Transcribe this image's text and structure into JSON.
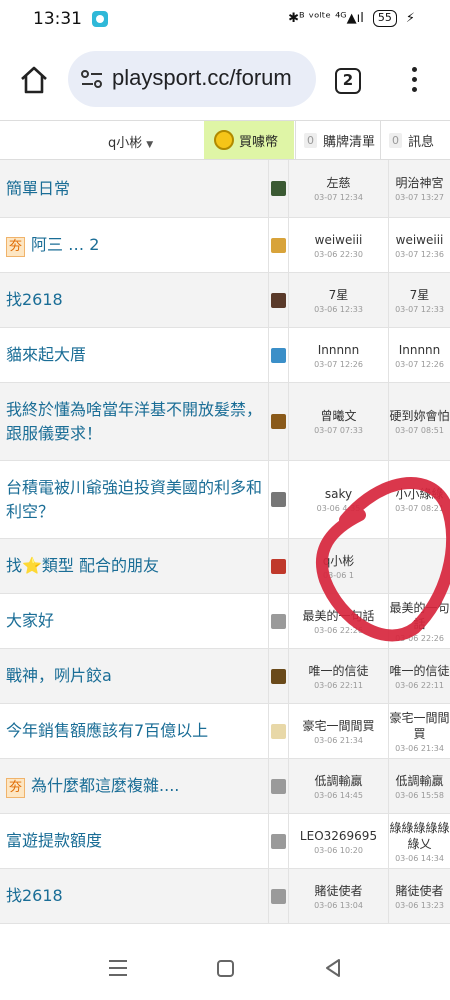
{
  "status_bar": {
    "time": "13:31",
    "indicators": "✱ᴮ ᵛᵒˡᵗᵉ ⁴ᴳ▲ıl",
    "battery": "55"
  },
  "browser": {
    "url": "playsport.cc/forum",
    "tab_count": "2"
  },
  "site_nav": {
    "user": "q小彬",
    "coin_label": "買噱幣",
    "items": [
      {
        "count": "0",
        "label": "購牌清單"
      },
      {
        "count": "0",
        "label": "訊息"
      }
    ]
  },
  "rows": [
    {
      "tag": "",
      "title": "簡單日常",
      "author": "左慈",
      "author_time": "03-07 12:34",
      "last": "明治神宮",
      "last_time": "03-07 13:27",
      "thumb_color": "#3b5a33"
    },
    {
      "tag": "夯",
      "title": "阿三 … 2",
      "author": "weiweiii",
      "author_time": "03-06 22:30",
      "last": "weiweiii",
      "last_time": "03-07 12:36",
      "thumb_color": "#d8a33a"
    },
    {
      "tag": "",
      "title": "找2618",
      "author": "7星",
      "author_time": "03-06 12:33",
      "last": "7星",
      "last_time": "03-07 12:33",
      "thumb_color": "#5a3a2a"
    },
    {
      "tag": "",
      "title": "貓來起大厝",
      "author": "Innnnn",
      "author_time": "03-07 12:26",
      "last": "Innnnn",
      "last_time": "03-07 12:26",
      "thumb_color": "#3b8fc8"
    },
    {
      "tag": "",
      "title": "我終於懂為啥當年洋基不開放髮禁，跟服儀要求！",
      "author": "曾曦文",
      "author_time": "03-07 07:33",
      "last": "硬到妳會怕",
      "last_time": "03-07 08:51",
      "thumb_color": "#8a5a1a"
    },
    {
      "tag": "",
      "title": "台積電被川爺強迫投資美國的利多和利空？",
      "author": "saky",
      "author_time": "03-06 4:35",
      "last": "小小綠綠",
      "last_time": "03-07 08:21",
      "thumb_color": "#777777"
    },
    {
      "tag": "",
      "title": "找⭐類型 配合的朋友",
      "author": "q小彬",
      "author_time": "03-06 1",
      "last": "",
      "last_time": "",
      "thumb_color": "#c0392b"
    },
    {
      "tag": "",
      "title": "大家好",
      "author": "最美的一句話",
      "author_time": "03-06 22:26",
      "last": "最美的一句話",
      "last_time": "03-06 22:26",
      "thumb_color": "#9a9a9a"
    },
    {
      "tag": "",
      "title": "戰神，咧片餃a",
      "author": "唯一的信徒",
      "author_time": "03-06 22:11",
      "last": "唯一的信徒",
      "last_time": "03-06 22:11",
      "thumb_color": "#6a4a1a"
    },
    {
      "tag": "",
      "title": "今年銷售額應該有7百億以上",
      "author": "豪宅一間間買",
      "author_time": "03-06 21:34",
      "last": "豪宅一間間買",
      "last_time": "03-06 21:34",
      "thumb_color": "#e8d8a8"
    },
    {
      "tag": "夯",
      "title": "為什麼都這麼複雜....",
      "author": "低調輸贏",
      "author_time": "03-06 14:45",
      "last": "低調輸贏",
      "last_time": "03-06 15:58",
      "thumb_color": "#9a9a9a"
    },
    {
      "tag": "",
      "title": "富遊提款額度",
      "author": "LEO3269695",
      "author_time": "03-06 10:20",
      "last": "綠綠綠綠綠綠乂",
      "last_time": "03-06 14:34",
      "thumb_color": "#9a9a9a"
    },
    {
      "tag": "",
      "title": "找2618",
      "author": "賭徒使者",
      "author_time": "03-06 13:04",
      "last": "賭徒使者",
      "last_time": "03-06 13:23",
      "thumb_color": "#9a9a9a"
    }
  ],
  "colors": {
    "link": "#1a6d96",
    "tag_text": "#e06a00",
    "coin_bg": "#dff5a6",
    "annotation": "#d7263d"
  }
}
